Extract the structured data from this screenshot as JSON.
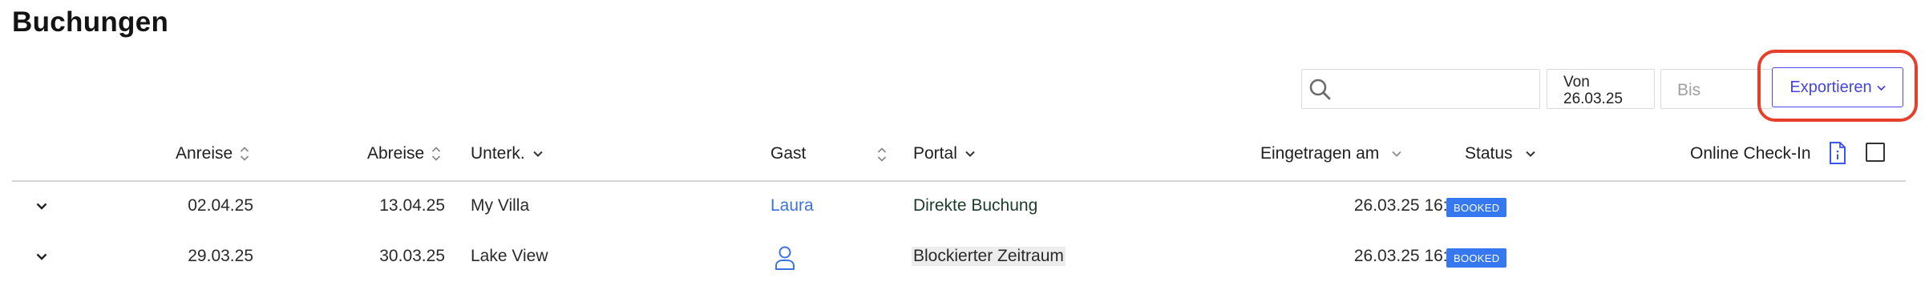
{
  "page": {
    "title": "Buchungen"
  },
  "toolbar": {
    "search_value": "",
    "date_from_label": "Von",
    "date_from_value": "26.03.25",
    "date_to_placeholder": "Bis",
    "export_label": "Exportieren",
    "export_highlight_color": "#e6402c"
  },
  "table": {
    "headers": {
      "arrival": "Anreise",
      "departure": "Abreise",
      "unit": "Unterk.",
      "guest": "Gast",
      "portal": "Portal",
      "created": "Eingetragen am",
      "status": "Status",
      "checkin": "Online Check-In"
    },
    "rows": [
      {
        "arrival": "02.04.25",
        "departure": "13.04.25",
        "unit": "My Villa",
        "guest": "Laura",
        "guest_icon": null,
        "portal": "Direkte Buchung",
        "created": "26.03.25 16:10",
        "status": "BOOKED"
      },
      {
        "arrival": "29.03.25",
        "departure": "30.03.25",
        "unit": "Lake View",
        "guest": "",
        "guest_icon": "user-icon",
        "portal": "Blockierter Zeitraum",
        "created": "26.03.25 16:09",
        "status": "BOOKED"
      }
    ]
  },
  "colors": {
    "accent": "#4545e0",
    "link": "#3b73e0",
    "badge": "#3578f0"
  }
}
